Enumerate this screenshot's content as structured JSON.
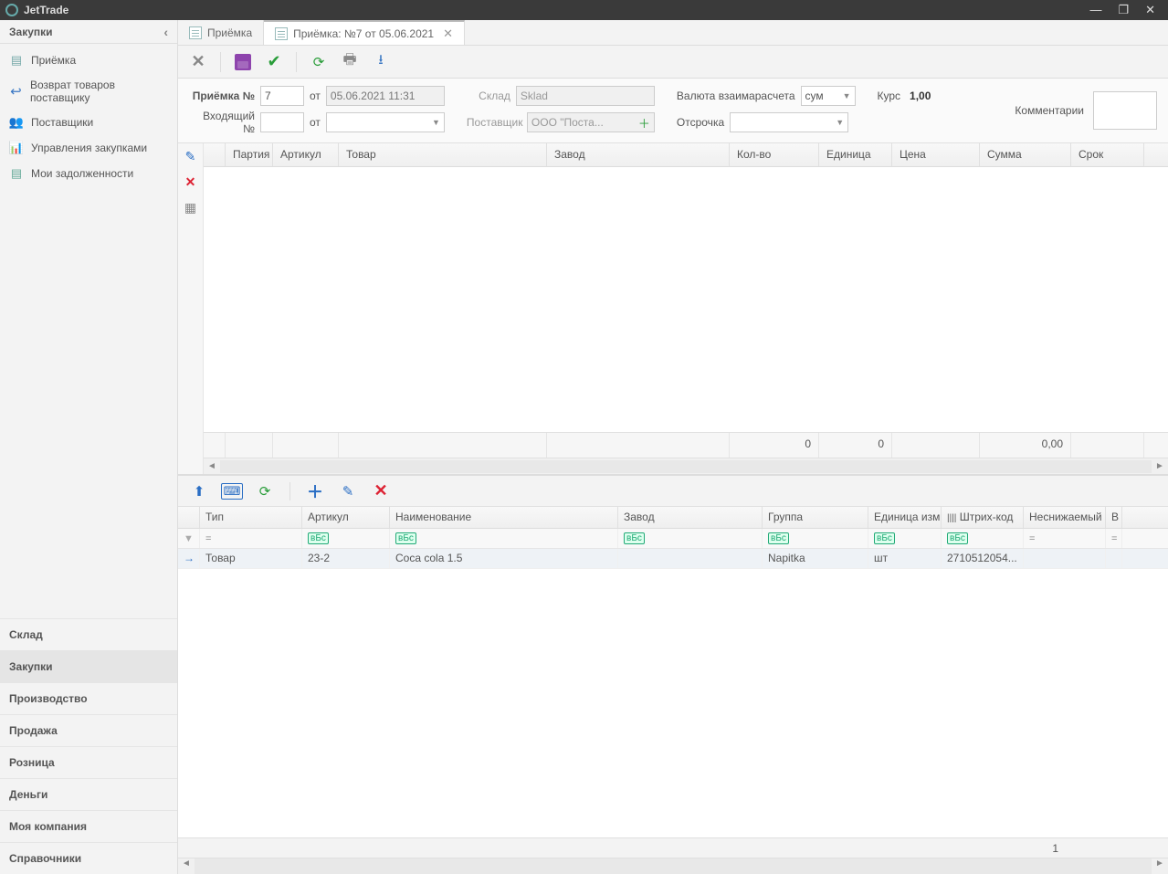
{
  "app": {
    "title": "JetTrade"
  },
  "win_controls": {
    "minimize": "—",
    "maximize": "❐",
    "close": "✕"
  },
  "sidebar": {
    "header": "Закупки",
    "items": [
      {
        "label": "Приёмка"
      },
      {
        "label": "Возврат товаров поставщику"
      },
      {
        "label": "Поставщики"
      },
      {
        "label": "Управления закупками"
      },
      {
        "label": "Мои задолженности"
      }
    ],
    "sections": [
      {
        "label": "Склад"
      },
      {
        "label": "Закупки"
      },
      {
        "label": "Производство"
      },
      {
        "label": "Продажа"
      },
      {
        "label": "Розница"
      },
      {
        "label": "Деньги"
      },
      {
        "label": "Моя компания"
      },
      {
        "label": "Справочники"
      }
    ]
  },
  "tabs": [
    {
      "label": "Приёмка",
      "closable": false
    },
    {
      "label": "Приёмка: №7 от 05.06.2021",
      "closable": true
    }
  ],
  "form": {
    "priemka_label": "Приёмка №",
    "priemka_no": "7",
    "ot_label": "от",
    "date": "05.06.2021 11:31",
    "sklad_label": "Склад",
    "sklad": "Sklad",
    "valuta_label": "Валюта взаимарасчета",
    "valuta": "сум",
    "kurs_label": "Курс",
    "kurs": "1,00",
    "incoming_label": "Входящий №",
    "incoming_no": "",
    "postavshik_label": "Поставщик",
    "postavshik": "ООО \"Поста...",
    "otsrochka_label": "Отсрочка",
    "otsrochka": "",
    "comment_label": "Комментарии"
  },
  "topgrid": {
    "columns": [
      "Партия",
      "Артикул",
      "Товар",
      "Завод",
      "Кол-во",
      "Единица",
      "Цена",
      "Сумма",
      "Срок"
    ],
    "summary": {
      "qty": "0",
      "unit": "0",
      "sum": "0,00"
    }
  },
  "bottomgrid": {
    "columns": [
      "Тип",
      "Артикул",
      "Наименование",
      "Завод",
      "Группа",
      "Единица изм.",
      "Штрих-код",
      "Неснижаемый ...",
      "В"
    ],
    "filter_eq": "=",
    "rows": [
      {
        "typ": "Товар",
        "art": "23-2",
        "name": "Coca cola 1.5",
        "zav": "",
        "grp": "Napitka",
        "ed": "шт",
        "bar": "2710512054...",
        "nes": ""
      }
    ],
    "count": "1"
  }
}
